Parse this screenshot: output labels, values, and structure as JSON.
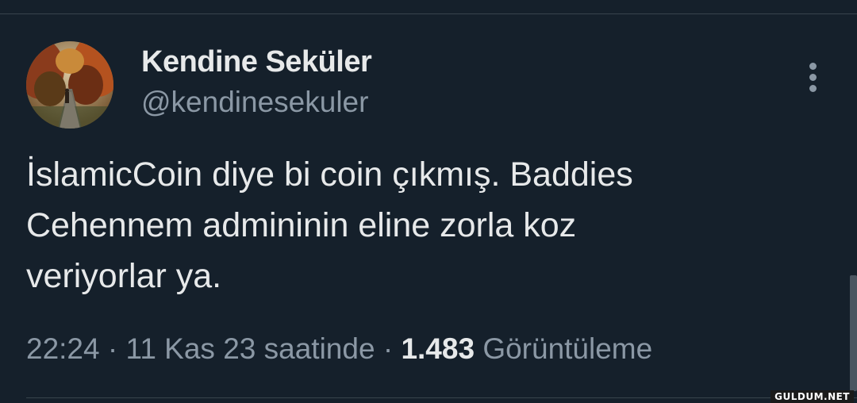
{
  "tweet": {
    "author": {
      "display_name": "Kendine Seküler",
      "handle": "@kendinesekuler"
    },
    "text_lines": [
      "İslamicCoin diye bi coin çıkmış. Baddies",
      "Cehennem admininin eline zorla koz",
      "veriyorlar ya."
    ],
    "meta": {
      "time": "22:24",
      "separator": " · ",
      "date": "11 Kas 23 saatinde",
      "views_count": "1.483",
      "views_label": "Görüntüleme"
    },
    "more_icon": "more-vertical-icon"
  },
  "watermark": {
    "text": "GULDUM.NET"
  },
  "colors": {
    "background": "#15202b",
    "primary_text": "#e7e9ea",
    "secondary_text": "#8b98a5",
    "divider": "#38444d"
  }
}
